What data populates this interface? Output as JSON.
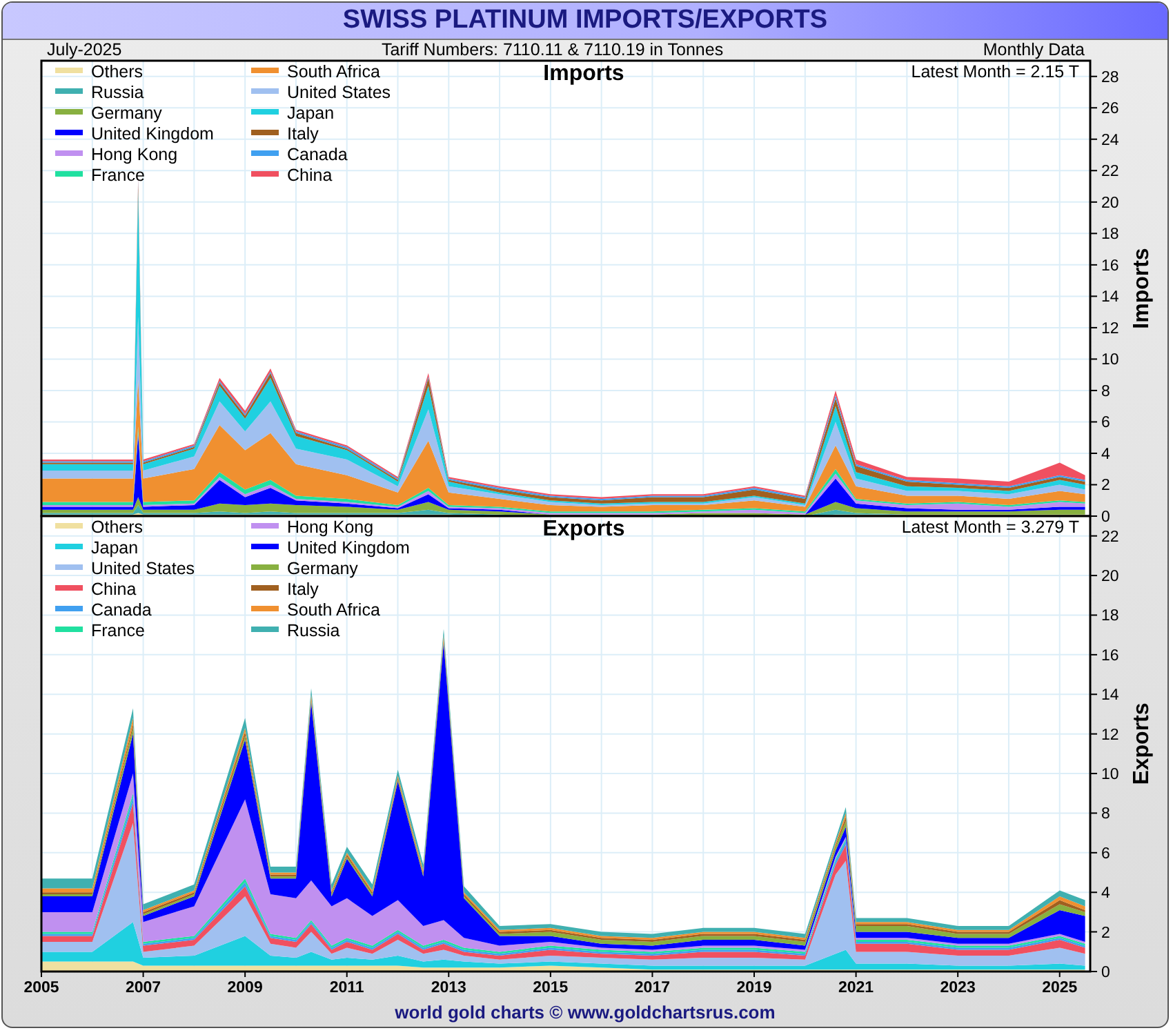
{
  "header": {
    "title": "SWISS PLATINUM IMPORTS/EXPORTS"
  },
  "subheader": {
    "date": "July-2025",
    "tariff": "Tariff Numbers: 7110.11 & 7110.19 in Tonnes",
    "frequency": "Monthly Data"
  },
  "charts": [
    {
      "latest": "Latest Month = 2.15 T",
      "axis_title": "Imports",
      "chart_data": {
        "type": "area",
        "title": "Imports",
        "stacked": true,
        "grid": true,
        "legend": "upper left",
        "xlim": [
          2005,
          2025.6
        ],
        "ylim": [
          0,
          29
        ],
        "yticks": [
          0,
          2,
          4,
          6,
          8,
          10,
          12,
          14,
          16,
          18,
          20,
          22,
          24,
          26,
          28
        ],
        "x": [
          2005,
          2006,
          2006.8,
          2006.9,
          2007,
          2008,
          2008.5,
          2009,
          2009.5,
          2010,
          2011,
          2012,
          2012.6,
          2013,
          2014,
          2015,
          2016,
          2017,
          2018,
          2019,
          2020,
          2020.6,
          2021,
          2022,
          2023,
          2024,
          2025,
          2025.5
        ],
        "series": [
          {
            "name": "Others",
            "color": "#f0e0a0",
            "values": [
              0.1,
              0.1,
              0.1,
              0.2,
              0.1,
              0.1,
              0.1,
              0.1,
              0.1,
              0.1,
              0.1,
              0.1,
              0.1,
              0.1,
              0,
              0,
              0,
              0,
              0,
              0,
              0,
              0.1,
              0.1,
              0.1,
              0.1,
              0.1,
              0.1,
              0.1
            ]
          },
          {
            "name": "Russia",
            "color": "#40b0b0",
            "values": [
              0.1,
              0.1,
              0.1,
              0.5,
              0.1,
              0.1,
              0.2,
              0.1,
              0.2,
              0.1,
              0.1,
              0.1,
              0.3,
              0.1,
              0.1,
              0,
              0,
              0,
              0,
              0,
              0,
              0.3,
              0.1,
              0,
              0,
              0,
              0,
              0
            ]
          },
          {
            "name": "Germany",
            "color": "#88b040",
            "values": [
              0.2,
              0.2,
              0.2,
              0.5,
              0.2,
              0.2,
              0.5,
              0.5,
              0.5,
              0.5,
              0.4,
              0.2,
              0.5,
              0.2,
              0.2,
              0.1,
              0.1,
              0.1,
              0.2,
              0.2,
              0.1,
              0.5,
              0.3,
              0.2,
              0.2,
              0.2,
              0.3,
              0.3
            ]
          },
          {
            "name": "United Kingdom",
            "color": "#0000ff",
            "values": [
              0.2,
              0.2,
              0.2,
              4,
              0.2,
              0.3,
              1.5,
              0.5,
              1,
              0.3,
              0.2,
              0.1,
              0.5,
              0.1,
              0.1,
              0,
              0,
              0,
              0,
              0,
              0,
              1.5,
              0.3,
              0.2,
              0.1,
              0.1,
              0.2,
              0.2
            ]
          },
          {
            "name": "Hong Kong",
            "color": "#c090f0",
            "values": [
              0.1,
              0.1,
              0.1,
              0.2,
              0.1,
              0.1,
              0.2,
              0.2,
              0.2,
              0.1,
              0.1,
              0.1,
              0.2,
              0.1,
              0.1,
              0.1,
              0.1,
              0.1,
              0.1,
              0.2,
              0.1,
              0.3,
              0.2,
              0.2,
              0.4,
              0.2,
              0.3,
              0.2
            ]
          },
          {
            "name": "France",
            "color": "#20e0a0",
            "values": [
              0.2,
              0.2,
              0.2,
              0.3,
              0.2,
              0.2,
              0.3,
              0.3,
              0.3,
              0.2,
              0.2,
              0.1,
              0.2,
              0.1,
              0.1,
              0.1,
              0.1,
              0.1,
              0.1,
              0.1,
              0.1,
              0.3,
              0.1,
              0.1,
              0.1,
              0.1,
              0.1,
              0.1
            ]
          },
          {
            "name": "South Africa",
            "color": "#f09030",
            "values": [
              1.5,
              1.5,
              1.5,
              3,
              1.5,
              2,
              3,
              2.5,
              3,
              2,
              1.5,
              0.8,
              3,
              0.8,
              0.5,
              0.4,
              0.3,
              0.4,
              0.3,
              0.5,
              0.3,
              1.5,
              0.8,
              0.5,
              0.4,
              0.4,
              0.6,
              0.5
            ]
          },
          {
            "name": "United States",
            "color": "#a0c0f0",
            "values": [
              0.5,
              0.5,
              0.5,
              4,
              0.5,
              0.8,
              1.5,
              1.2,
              2,
              1,
              1,
              0.4,
              2,
              0.4,
              0.3,
              0.2,
              0.1,
              0.1,
              0.1,
              0.2,
              0.1,
              1.5,
              0.5,
              0.3,
              0.3,
              0.3,
              0.4,
              0.3
            ]
          },
          {
            "name": "Japan",
            "color": "#20d0e0",
            "values": [
              0.4,
              0.4,
              0.4,
              8,
              0.4,
              0.5,
              1,
              0.8,
              1.5,
              0.8,
              0.6,
              0.3,
              1.5,
              0.3,
              0.1,
              0.1,
              0.1,
              0.1,
              0.1,
              0.1,
              0.1,
              1,
              0.4,
              0.3,
              0.2,
              0.2,
              0.3,
              0.3
            ]
          },
          {
            "name": "Italy",
            "color": "#a06020",
            "values": [
              0.1,
              0.1,
              0.1,
              0.5,
              0.1,
              0.1,
              0.2,
              0.2,
              0.3,
              0.2,
              0.1,
              0.1,
              0.5,
              0.1,
              0.2,
              0.2,
              0.2,
              0.3,
              0.3,
              0.4,
              0.3,
              0.5,
              0.4,
              0.3,
              0.2,
              0.2,
              0.2,
              0.2
            ]
          },
          {
            "name": "Canada",
            "color": "#40a0f0",
            "values": [
              0.1,
              0.1,
              0.1,
              0.2,
              0.1,
              0.1,
              0.1,
              0.1,
              0.1,
              0.1,
              0.1,
              0.1,
              0.1,
              0.1,
              0.1,
              0.1,
              0.1,
              0.1,
              0.1,
              0.1,
              0.1,
              0.2,
              0.1,
              0.1,
              0.1,
              0.1,
              0.1,
              0.1
            ]
          },
          {
            "name": "China",
            "color": "#f05060",
            "values": [
              0.1,
              0.1,
              0.1,
              0.2,
              0.1,
              0.1,
              0.2,
              0.2,
              0.2,
              0.1,
              0.1,
              0.1,
              0.2,
              0.1,
              0.1,
              0.1,
              0.1,
              0.1,
              0.1,
              0.1,
              0.1,
              0.3,
              0.3,
              0.2,
              0.3,
              0.3,
              0.8,
              0.3
            ]
          }
        ]
      }
    },
    {
      "latest": "Latest Month = 3.279 T",
      "axis_title": "Exports",
      "chart_data": {
        "type": "area",
        "title": "Exports",
        "stacked": true,
        "grid": true,
        "legend": "upper left",
        "xlim": [
          2005,
          2025.6
        ],
        "ylim": [
          0,
          23
        ],
        "yticks": [
          0,
          2,
          4,
          6,
          8,
          10,
          12,
          14,
          16,
          18,
          20,
          22
        ],
        "xticks": [
          2005,
          2007,
          2009,
          2011,
          2013,
          2015,
          2017,
          2019,
          2021,
          2023,
          2025
        ],
        "x": [
          2005,
          2006,
          2006.8,
          2007,
          2008,
          2009,
          2009.5,
          2010,
          2010.3,
          2010.7,
          2011,
          2011.5,
          2012,
          2012.5,
          2012.9,
          2013.3,
          2014,
          2015,
          2016,
          2017,
          2018,
          2019,
          2020,
          2020.6,
          2020.8,
          2021,
          2022,
          2023,
          2024,
          2025,
          2025.5
        ],
        "series": [
          {
            "name": "Others",
            "color": "#f0e0a0",
            "values": [
              0.5,
              0.5,
              0.5,
              0.3,
              0.3,
              0.3,
              0.3,
              0.3,
              0.3,
              0.3,
              0.3,
              0.3,
              0.3,
              0.2,
              0.2,
              0.2,
              0.2,
              0.3,
              0.2,
              0.1,
              0.1,
              0.1,
              0.1,
              0.1,
              0.1,
              0.1,
              0.1,
              0.1,
              0.1,
              0.1,
              0.1
            ]
          },
          {
            "name": "Japan",
            "color": "#20d0e0",
            "values": [
              0.5,
              0.5,
              2,
              0.4,
              0.5,
              1.5,
              0.5,
              0.4,
              0.7,
              0.3,
              0.4,
              0.3,
              0.5,
              0.3,
              0.4,
              0.3,
              0.2,
              0.2,
              0.2,
              0.2,
              0.2,
              0.2,
              0.2,
              0.8,
              1,
              0.3,
              0.3,
              0.2,
              0.2,
              0.3,
              0.2
            ]
          },
          {
            "name": "United States",
            "color": "#a0c0f0",
            "values": [
              0.5,
              0.5,
              5,
              0.3,
              0.5,
              2,
              0.6,
              0.5,
              1,
              0.3,
              0.5,
              0.3,
              0.8,
              0.4,
              0.5,
              0.3,
              0.2,
              0.3,
              0.3,
              0.3,
              0.4,
              0.4,
              0.3,
              4,
              4.5,
              0.6,
              0.6,
              0.5,
              0.5,
              0.8,
              0.6
            ]
          },
          {
            "name": "China",
            "color": "#f05060",
            "values": [
              0.3,
              0.3,
              1,
              0.3,
              0.3,
              0.5,
              0.3,
              0.3,
              0.4,
              0.2,
              0.3,
              0.2,
              0.3,
              0.2,
              0.3,
              0.2,
              0.2,
              0.3,
              0.2,
              0.2,
              0.3,
              0.3,
              0.2,
              0.5,
              0.8,
              0.4,
              0.4,
              0.3,
              0.3,
              0.4,
              0.3
            ]
          },
          {
            "name": "Canada",
            "color": "#40a0f0",
            "values": [
              0.1,
              0.1,
              0.3,
              0.1,
              0.1,
              0.2,
              0.1,
              0.1,
              0.1,
              0.1,
              0.1,
              0.1,
              0.1,
              0.1,
              0.1,
              0.1,
              0.1,
              0.1,
              0.1,
              0.1,
              0.1,
              0.1,
              0.1,
              0.2,
              0.2,
              0.1,
              0.1,
              0.1,
              0.1,
              0.1,
              0.1
            ]
          },
          {
            "name": "France",
            "color": "#20e0a0",
            "values": [
              0.1,
              0.1,
              0.2,
              0.1,
              0.1,
              0.2,
              0.1,
              0.1,
              0.1,
              0.1,
              0.1,
              0.1,
              0.1,
              0.1,
              0.1,
              0.1,
              0.1,
              0.1,
              0.1,
              0.1,
              0.1,
              0.1,
              0.1,
              0.1,
              0.1,
              0.1,
              0.1,
              0.1,
              0.1,
              0.1,
              0.1
            ]
          },
          {
            "name": "Hong Kong",
            "color": "#c090f0",
            "values": [
              1,
              1,
              1,
              1,
              1.5,
              4,
              2,
              2,
              2,
              2,
              2,
              1.5,
              1.5,
              1,
              1,
              0.5,
              0.3,
              0.2,
              0.1,
              0.1,
              0.1,
              0.1,
              0.1,
              0.1,
              0.1,
              0.1,
              0.1,
              0.1,
              0.1,
              0.1,
              0.1
            ]
          },
          {
            "name": "United Kingdom",
            "color": "#0000ff",
            "values": [
              0.8,
              0.8,
              2,
              0.3,
              0.5,
              3,
              0.8,
              1,
              9,
              0.5,
              2,
              1,
              6,
              2.5,
              14,
              2,
              0.5,
              0.3,
              0.2,
              0.2,
              0.3,
              0.3,
              0.2,
              0.3,
              0.5,
              0.3,
              0.3,
              0.3,
              0.3,
              1.2,
              1.3
            ]
          },
          {
            "name": "Germany",
            "color": "#88b040",
            "values": [
              0.1,
              0.1,
              0.3,
              0.1,
              0.1,
              0.2,
              0.1,
              0.1,
              0.1,
              0.1,
              0.1,
              0.1,
              0.1,
              0.1,
              0.1,
              0.1,
              0.1,
              0.2,
              0.2,
              0.2,
              0.2,
              0.2,
              0.2,
              0.2,
              0.3,
              0.3,
              0.3,
              0.2,
              0.2,
              0.3,
              0.2
            ]
          },
          {
            "name": "Italy",
            "color": "#a06020",
            "values": [
              0.1,
              0.1,
              0.2,
              0.1,
              0.1,
              0.2,
              0.1,
              0.1,
              0.1,
              0.1,
              0.1,
              0.1,
              0.1,
              0.1,
              0.1,
              0.1,
              0.1,
              0.1,
              0.1,
              0.1,
              0.1,
              0.1,
              0.1,
              0.1,
              0.2,
              0.1,
              0.1,
              0.1,
              0.1,
              0.2,
              0.1
            ]
          },
          {
            "name": "South Africa",
            "color": "#f09030",
            "values": [
              0.2,
              0.2,
              0.3,
              0.1,
              0.1,
              0.2,
              0.1,
              0.1,
              0.2,
              0.1,
              0.1,
              0.1,
              0.1,
              0.1,
              0.2,
              0.1,
              0.1,
              0.1,
              0.1,
              0.1,
              0.1,
              0.1,
              0.1,
              0.1,
              0.2,
              0.1,
              0.1,
              0.1,
              0.1,
              0.2,
              0.2
            ]
          },
          {
            "name": "Russia",
            "color": "#40b0b0",
            "values": [
              0.5,
              0.5,
              0.5,
              0.3,
              0.3,
              0.5,
              0.3,
              0.3,
              0.3,
              0.3,
              0.3,
              0.3,
              0.3,
              0.3,
              0.3,
              0.3,
              0.2,
              0.2,
              0.2,
              0.2,
              0.2,
              0.2,
              0.2,
              0.2,
              0.3,
              0.2,
              0.2,
              0.2,
              0.2,
              0.3,
              0.3
            ]
          }
        ]
      }
    }
  ],
  "footer": "world gold charts © www.goldchartsrus.com"
}
